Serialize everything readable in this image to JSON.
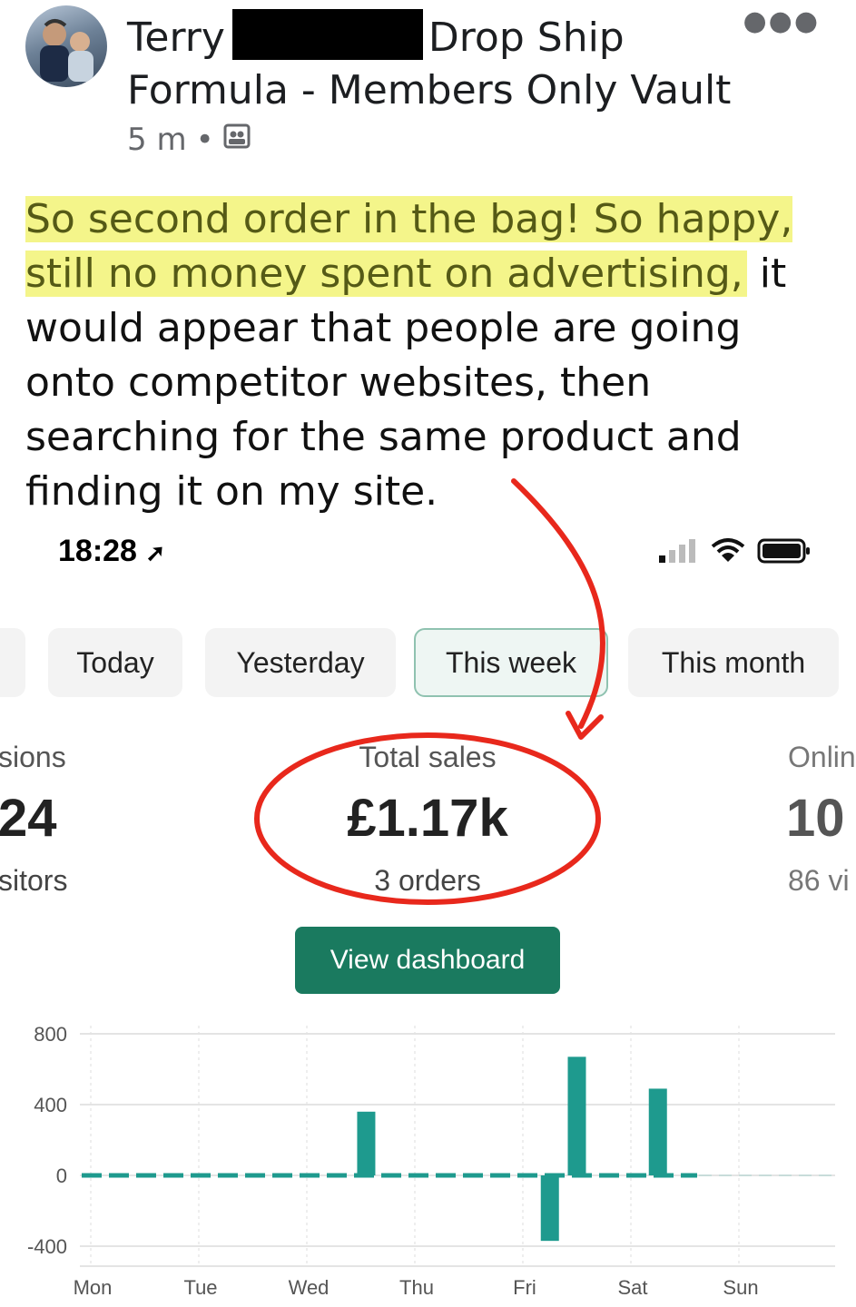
{
  "post": {
    "author_first": "Terry",
    "author_rest_line1": "Drop Ship",
    "author_line2": "Formula - Members Only Vault",
    "time": "5 m",
    "separator": "•",
    "text_highlighted": "So second order in the bag! So happy, still no money spent on advertising,",
    "text_rest": " it would appear that people are going onto competitor websites, then searching for the same product and finding it on my site."
  },
  "phone": {
    "status_time": "18:28",
    "tabs": [
      {
        "label": "Today"
      },
      {
        "label": "Yesterday"
      },
      {
        "label": "This week",
        "active": true
      },
      {
        "label": "This month"
      }
    ],
    "metrics": {
      "left": {
        "label": "sions",
        "value": "24",
        "sub": "sitors"
      },
      "center": {
        "label": "Total sales",
        "value": "£1.17k",
        "sub": "3 orders"
      },
      "right": {
        "label": "Onlin",
        "value": "10",
        "sub": "86 vi"
      }
    },
    "dashboard_button": "View dashboard"
  },
  "colors": {
    "highlight": "#f4f58a",
    "accent_green": "#1a7a5f",
    "bar_teal": "#1e9a8e",
    "annotation_red": "#e8281c"
  },
  "chart_data": {
    "type": "bar",
    "ylim": [
      -500,
      800
    ],
    "yticks": [
      800,
      400,
      0,
      -400
    ],
    "xticks": [
      "Mon",
      "Tue",
      "Wed",
      "Thu",
      "Fri",
      "Sat",
      "Sun"
    ],
    "grid": true,
    "bars": [
      {
        "day_pos": 2.55,
        "value": 360
      },
      {
        "day_pos": 4.25,
        "value": -370
      },
      {
        "day_pos": 4.5,
        "value": 670
      },
      {
        "day_pos": 5.25,
        "value": 490
      }
    ]
  }
}
